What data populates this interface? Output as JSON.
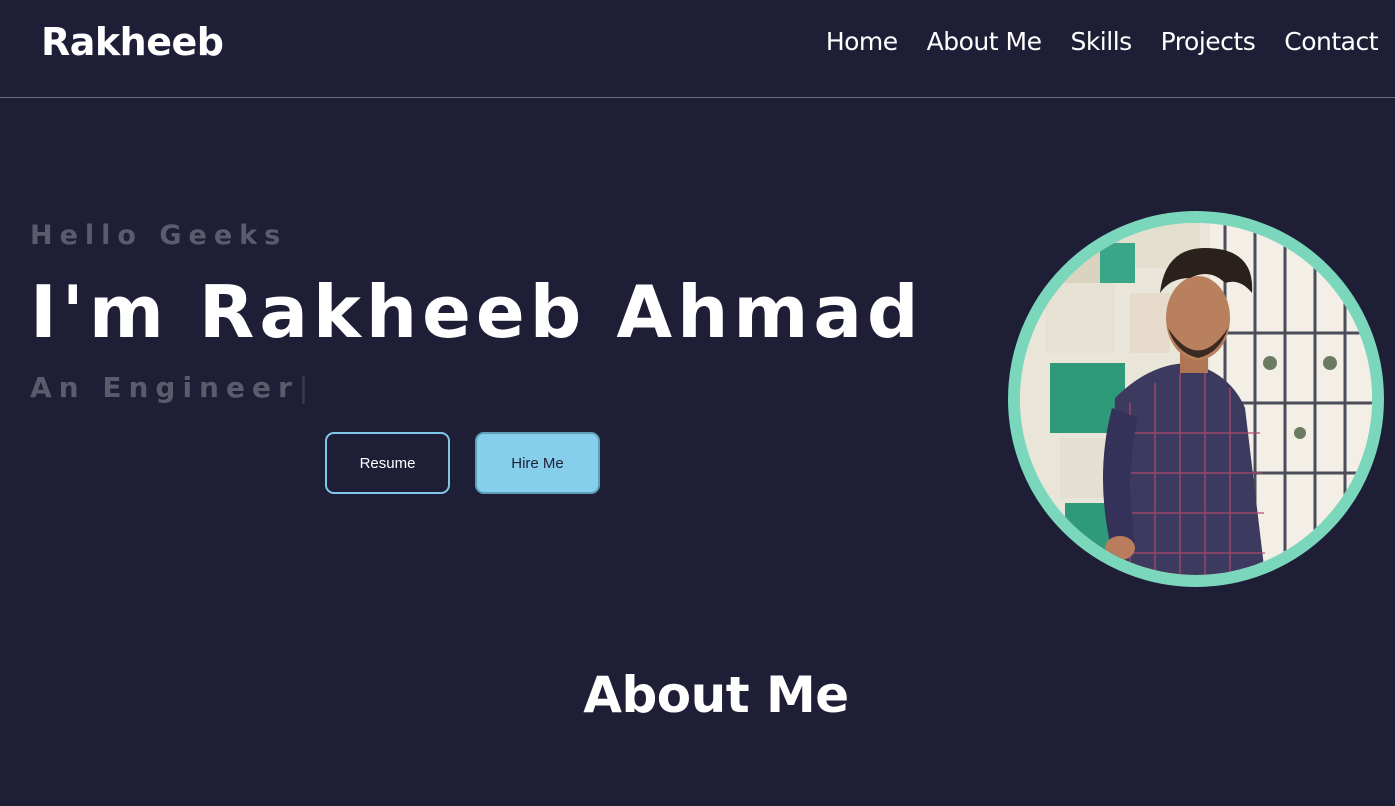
{
  "header": {
    "logo": "Rakheeb",
    "nav": [
      "Home",
      "About Me",
      "Skills",
      "Projects",
      "Contact"
    ]
  },
  "hero": {
    "greeting": "Hello Geeks",
    "title": "I'm Rakheeb Ahmad",
    "role": "An Engineer",
    "cursor": "|",
    "resume_label": "Resume",
    "hire_label": "Hire Me"
  },
  "about": {
    "heading": "About Me"
  },
  "colors": {
    "background": "#1f1e37",
    "accent_ring": "#7ad7bc",
    "hire_button": "#85cfec",
    "muted_text": "#5c5b6e"
  }
}
